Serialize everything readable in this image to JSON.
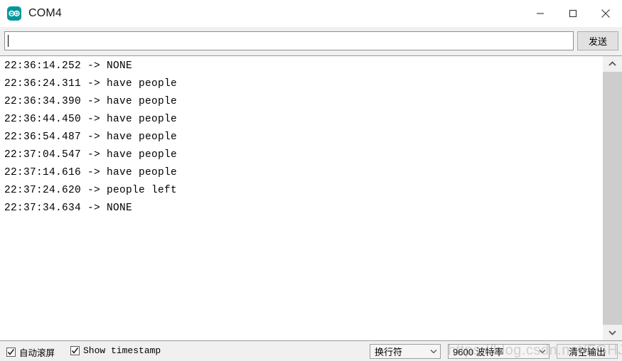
{
  "window": {
    "title": "COM4",
    "logo_icon": "arduino-logo",
    "controls": [
      {
        "name": "minimize-button",
        "icon": "minimize-icon"
      },
      {
        "name": "maximize-button",
        "icon": "maximize-icon"
      },
      {
        "name": "close-button",
        "icon": "close-icon"
      }
    ]
  },
  "toolbar": {
    "input_value": "",
    "input_placeholder": "",
    "send_label": "发送"
  },
  "log": {
    "lines": [
      "22:36:14.252 -> NONE",
      "22:36:24.311 -> have people",
      "22:36:34.390 -> have people",
      "22:36:44.450 -> have people",
      "22:36:54.487 -> have people",
      "22:37:04.547 -> have people",
      "22:37:14.616 -> have people",
      "22:37:24.620 -> people left",
      "22:37:34.634 -> NONE"
    ]
  },
  "scrollbar": {
    "up_icon": "chevron-up-icon",
    "down_icon": "chevron-down-icon"
  },
  "statusbar": {
    "autoscroll": {
      "label": "自动滚屏",
      "checked": true
    },
    "show_timestamp": {
      "label": "Show timestamp",
      "checked": true
    },
    "line_ending": {
      "value": "换行符"
    },
    "baud_rate": {
      "value": "9600 波特率"
    },
    "clear_output": {
      "label": "清空输出"
    }
  },
  "watermark": {
    "text": "https://blog.csdn.net/FGHJsue"
  },
  "colors": {
    "accent_teal": "#00979c",
    "titlebar_bg": "#ffffff",
    "toolbar_bg": "#f0f0f0",
    "log_bg": "#ffffff",
    "scroll_thumb": "#cdcdcd",
    "text": "#000000"
  }
}
